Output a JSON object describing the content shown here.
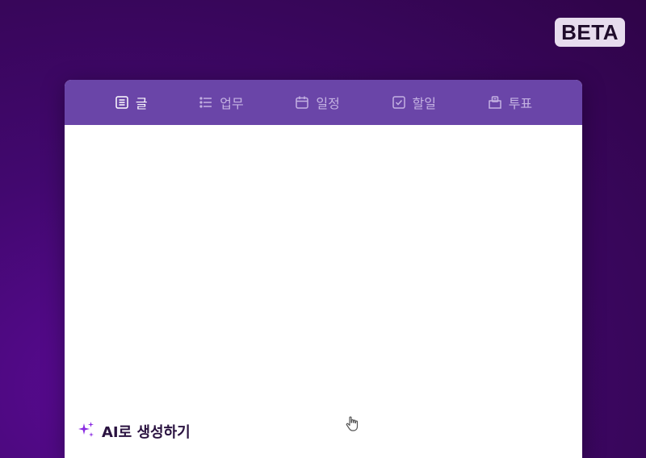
{
  "badge": {
    "label": "BETA"
  },
  "tabs": [
    {
      "label": "글",
      "icon": "document-icon",
      "active": true
    },
    {
      "label": "업무",
      "icon": "list-icon",
      "active": false
    },
    {
      "label": "일정",
      "icon": "calendar-icon",
      "active": false
    },
    {
      "label": "할일",
      "icon": "checkbox-icon",
      "active": false
    },
    {
      "label": "투표",
      "icon": "ballot-box-icon",
      "active": false
    }
  ],
  "ai": {
    "label": "AI로 생성하기",
    "icon": "sparkle-icon"
  },
  "colors": {
    "tabbar": "#6a45a8",
    "active_tab": "#ffffff",
    "inactive_tab": "#c4b2e2",
    "sparkle": "#8a2be2"
  }
}
